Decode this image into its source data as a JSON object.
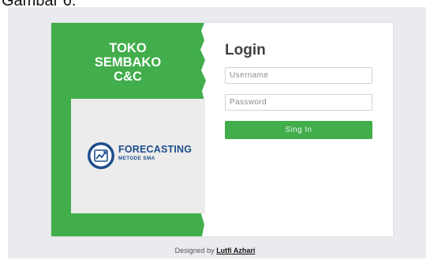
{
  "document": {
    "caption": "Gambar 6."
  },
  "brand": {
    "title_lines": [
      "TOKO",
      "SEMBAKO",
      "C&C"
    ],
    "logo_word": "FORECASTING",
    "logo_sub": "METODE SMA",
    "logo_icon": "trend-chart-icon"
  },
  "login": {
    "title": "Login",
    "username_placeholder": "Username",
    "password_placeholder": "Password",
    "signin_label": "Sing In"
  },
  "footer": {
    "prefix": "Designed by ",
    "author": "Lutfi Azhari"
  },
  "colors": {
    "brand_green": "#41ad4b",
    "logo_blue": "#1d4e8c",
    "page_bg": "#e9ebee"
  }
}
